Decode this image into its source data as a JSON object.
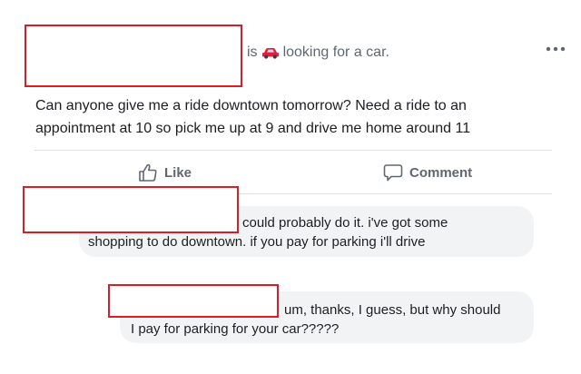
{
  "post": {
    "header": {
      "prefix": "is",
      "icon": "car-icon",
      "activity": "looking for a car."
    },
    "more_icon": "more-dots-icon",
    "body_line1": "Can anyone give me a ride downtown tomorrow? Need a ride to an",
    "body_line2": "appointment at 10 so pick me up at 9 and drive me home around 11"
  },
  "actions": {
    "like_label": "Like",
    "like_icon": "thumbs-up-icon",
    "comment_label": "Comment",
    "comment_icon": "speech-bubble-icon"
  },
  "comments": [
    {
      "line1": "could probably do it. i've got some",
      "line2": "shopping to do downtown. if you pay for parking i'll drive"
    },
    {
      "line1": "um, thanks, I guess, but why should",
      "line2": "I pay for parking for your car?????"
    }
  ],
  "colors": {
    "redaction_border": "#e01b24",
    "comment_bubble_bg": "#f2f3f5",
    "secondary_text": "#606770",
    "car_icon": "#e41e3f"
  }
}
